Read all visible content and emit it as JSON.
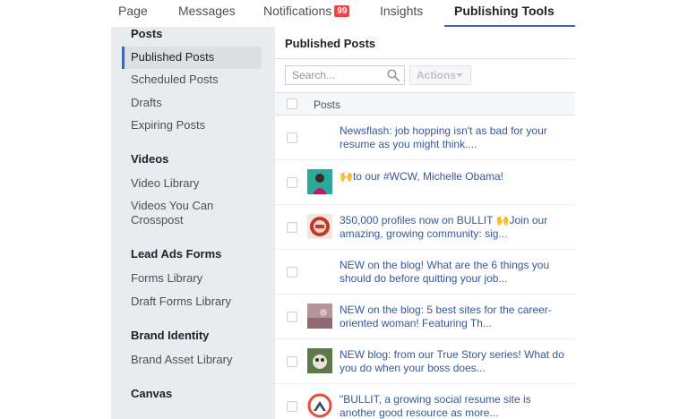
{
  "tabs": [
    {
      "label": "Page"
    },
    {
      "label": "Messages"
    },
    {
      "label": "Notifications",
      "badge": "99"
    },
    {
      "label": "Insights"
    },
    {
      "label": "Publishing Tools"
    }
  ],
  "sidebar": {
    "sections": [
      {
        "heading": "Posts",
        "items": [
          "Published Posts",
          "Scheduled Posts",
          "Drafts",
          "Expiring Posts"
        ]
      },
      {
        "heading": "Videos",
        "items": [
          "Video Library",
          "Videos You Can Crosspost"
        ]
      },
      {
        "heading": "Lead Ads Forms",
        "items": [
          "Forms Library",
          "Draft Forms Library"
        ]
      },
      {
        "heading": "Brand Identity",
        "items": [
          "Brand Asset Library"
        ]
      },
      {
        "heading": "Canvas",
        "items": []
      }
    ]
  },
  "main": {
    "title": "Published Posts",
    "search_placeholder": "Search...",
    "actions_label": "Actions",
    "column_header": "Posts",
    "posts": [
      {
        "text": "Newsflash: job hopping isn't as bad for your resume as you might think....",
        "thumb": "none"
      },
      {
        "text": "🙌to our #WCW, Michelle Obama!",
        "thumb": "teal-portrait"
      },
      {
        "text": "350,000 profiles now on BULLIT 🙌Join our amazing, growing community: sig...",
        "thumb": "red-badge"
      },
      {
        "text": "NEW on the blog! What are the 6 things you should do before quitting your job...",
        "thumb": "none"
      },
      {
        "text": "NEW on the blog: 5 best sites for the career-oriented woman! Featuring Th...",
        "thumb": "mauve-photo"
      },
      {
        "text": "NEW blog: from our True Story series! What do you do when your boss does...",
        "thumb": "green-photo"
      },
      {
        "text": "\"BULLIT, a growing social resume site is another good resource as more...",
        "thumb": "bullit-logo"
      }
    ]
  },
  "colors": {
    "accent": "#4267b2",
    "link": "#365899",
    "badge": "#fa3e3e",
    "sidebar_bg": "#e9ebee"
  }
}
